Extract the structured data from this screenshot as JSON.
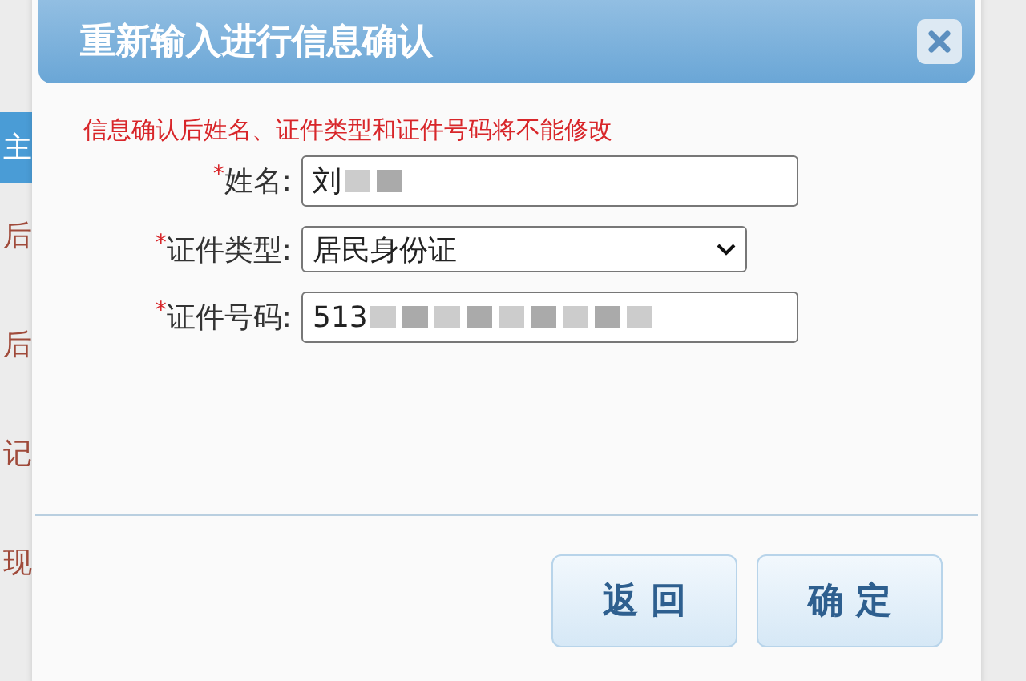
{
  "background": {
    "items": [
      {
        "text": "主",
        "selected": true
      },
      {
        "text": "后",
        "selected": false
      },
      {
        "text": "后",
        "selected": false
      },
      {
        "text": "记",
        "selected": false
      },
      {
        "text": "现",
        "selected": false
      }
    ]
  },
  "dialog": {
    "title": "重新输入进行信息确认",
    "notice": "信息确认后姓名、证件类型和证件号码将不能修改",
    "fields": [
      {
        "kind": "text",
        "required_mark": "*",
        "label": "姓名:",
        "value": "刘"
      },
      {
        "kind": "select",
        "required_mark": "*",
        "label": "证件类型:",
        "value": "居民身份证"
      },
      {
        "kind": "text",
        "required_mark": "*",
        "label": "证件号码:",
        "value": "513"
      }
    ],
    "buttons": [
      "返 回",
      "确 定"
    ]
  }
}
